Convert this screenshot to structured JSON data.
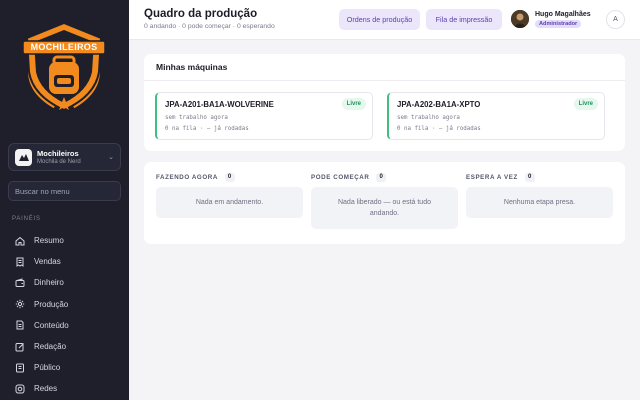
{
  "sidebar": {
    "logo_text": "MOCHILEIROS",
    "org": {
      "name": "Mochileiros",
      "subtitle": "Mochila de Nerd"
    },
    "search_placeholder": "Buscar no menu",
    "section_label": "PAINÉIS",
    "items": [
      {
        "label": "Resumo",
        "icon": "home-icon"
      },
      {
        "label": "Vendas",
        "icon": "receipt-icon"
      },
      {
        "label": "Dinheiro",
        "icon": "wallet-icon"
      },
      {
        "label": "Produção",
        "icon": "gear-icon"
      },
      {
        "label": "Conteúdo",
        "icon": "document-icon"
      },
      {
        "label": "Redação",
        "icon": "edit-icon"
      },
      {
        "label": "Público",
        "icon": "users-icon"
      },
      {
        "label": "Redes",
        "icon": "instagram-icon"
      }
    ]
  },
  "header": {
    "title": "Quadro da produção",
    "subtitle": "0 andando · 0 pode começar · 0 esperando",
    "orders_button": "Ordens de produção",
    "queue_button": "Fila de impressão",
    "user_name": "Hugo Magalhães",
    "user_role": "Administrador",
    "user_initial": "A"
  },
  "machines": {
    "title": "Minhas máquinas",
    "items": [
      {
        "name": "JPA-A201-BA1A-WOLVERINE",
        "status": "Livre",
        "job": "sem trabalho agora",
        "meta": "0 na fila · — já rodadas"
      },
      {
        "name": "JPA-A202-BA1A-XPTO",
        "status": "Livre",
        "job": "sem trabalho agora",
        "meta": "0 na fila · — já rodadas"
      }
    ]
  },
  "queue": {
    "columns": [
      {
        "title": "FAZENDO AGORA",
        "count": "0",
        "empty": "Nada em andamento."
      },
      {
        "title": "PODE COMEÇAR",
        "count": "0",
        "empty": "Nada liberado — ou está tudo andando."
      },
      {
        "title": "ESPERA A VEZ",
        "count": "0",
        "empty": "Nenhuma etapa presa."
      }
    ]
  },
  "colors": {
    "sidebar_bg": "#1e1f2b",
    "accent": "#5b3fb0",
    "success": "#3fbf7f",
    "logo_orange": "#f28a1e"
  }
}
